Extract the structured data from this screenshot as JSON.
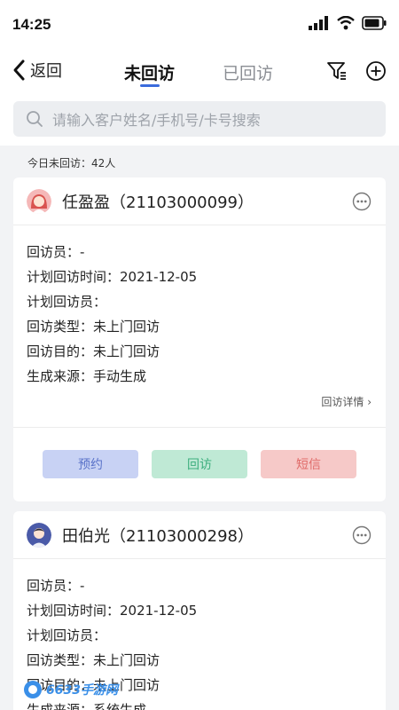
{
  "status_bar": {
    "time": "14:25"
  },
  "nav": {
    "back_label": "返回",
    "tabs": [
      {
        "label": "未回访",
        "active": true
      },
      {
        "label": "已回访",
        "active": false
      }
    ]
  },
  "search": {
    "placeholder": "请输入客户姓名/手机号/卡号搜索"
  },
  "summary": "今日未回访：42人",
  "cards": [
    {
      "name": "任盈盈（21103000099）",
      "rows": [
        "回访员：-",
        "计划回访时间：2021-12-05",
        "计划回访员：",
        "回访类型：未上门回访",
        "回访目的：未上门回访",
        "生成来源：手动生成"
      ],
      "detail_link": "回访详情 ›",
      "actions": {
        "book": "预约",
        "visit": "回访",
        "sms": "短信"
      }
    },
    {
      "name": "田伯光（21103000298）",
      "rows": [
        "回访员：-",
        "计划回访时间：2021-12-05",
        "计划回访员：",
        "回访类型：未上门回访",
        "回访目的：未上门回访",
        "生成来源：系统生成"
      ]
    }
  ],
  "watermark": "6633手游网",
  "colors": {
    "accent": "#3a6bdc",
    "book": "#c8d2f4",
    "visit": "#bfe9d5",
    "sms": "#f6c9c8"
  }
}
